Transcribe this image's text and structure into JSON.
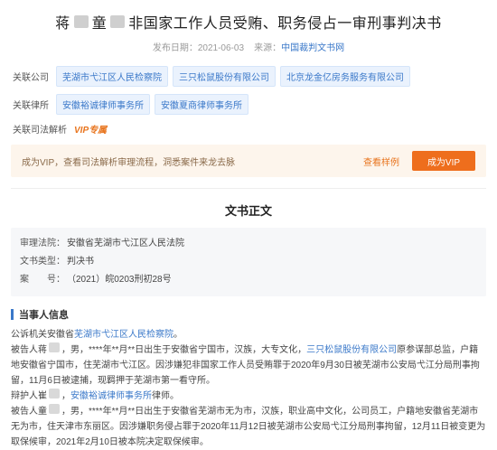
{
  "title": {
    "part1": "蒋",
    "part2": "童",
    "part3": "非国家工作人员受贿、职务侵占一审刑事判决书"
  },
  "meta": {
    "publish_label": "发布日期：",
    "publish_date": "2021-06-03",
    "source_label": "来源：",
    "source": "中国裁判文书网"
  },
  "related_companies": {
    "label": "关联公司",
    "items": [
      "芜湖市弋江区人民检察院",
      "三只松鼠股份有限公司",
      "北京龙金亿房务服务有限公司"
    ]
  },
  "related_firms": {
    "label": "关联律所",
    "items": [
      "安徽裕诚律师事务所",
      "安徽夏商律师事务所"
    ]
  },
  "judicial": {
    "label": "关联司法解析",
    "vip": "VIP专属"
  },
  "vip_banner": {
    "text": "成为VIP，查看司法解析审理流程，洞悉案件来龙去脉",
    "sample": "查看样例",
    "button": "成为VIP"
  },
  "document": {
    "heading": "文书正文",
    "court_key": "审理法院：",
    "court": "安徽省芜湖市弋江区人民法院",
    "type_key": "文书类型：",
    "type": "判决书",
    "case_key": "案　　号：",
    "case_no": "（2021）皖0203刑初28号"
  },
  "parties": {
    "heading": "当事人信息",
    "p1_prefix": "公诉机关安徽省",
    "p1_link": "芜湖市弋江区人民检察院",
    "p1_suffix": "。",
    "p2_a": "被告人蒋",
    "p2_b": "，男，****年**月**日出生于安徽省宁国市，汉族，大专文化，",
    "p2_link": "三只松鼠股份有限公司",
    "p2_c": "原参谋部总监，户籍地安徽省宁国市，住芜湖市弋江区。因涉嫌犯非国家工作人员受贿罪于2020年9月30日被芜湖市公安局弋江分局刑事拘留，11月6日被逮捕，现羁押于芜湖市第一看守所。",
    "p3_a": "辩护人崔",
    "p3_b": "，",
    "p3_link": "安徽裕诚律师事务所",
    "p3_c": "律师。",
    "p4_a": "被告人童",
    "p4_b": "，男，****年**月**日出生于安徽省芜湖市无为市，汉族，职业高中文化，公司员工，户籍地安徽省芜湖市无为市，住天津市东丽区。因涉嫌职务侵占罪于2020年11月12日被芜湖市公安局弋江分局刑事拘留，12月11日被变更为取保候审，2021年2月10日被本院决定取保候审。"
  }
}
